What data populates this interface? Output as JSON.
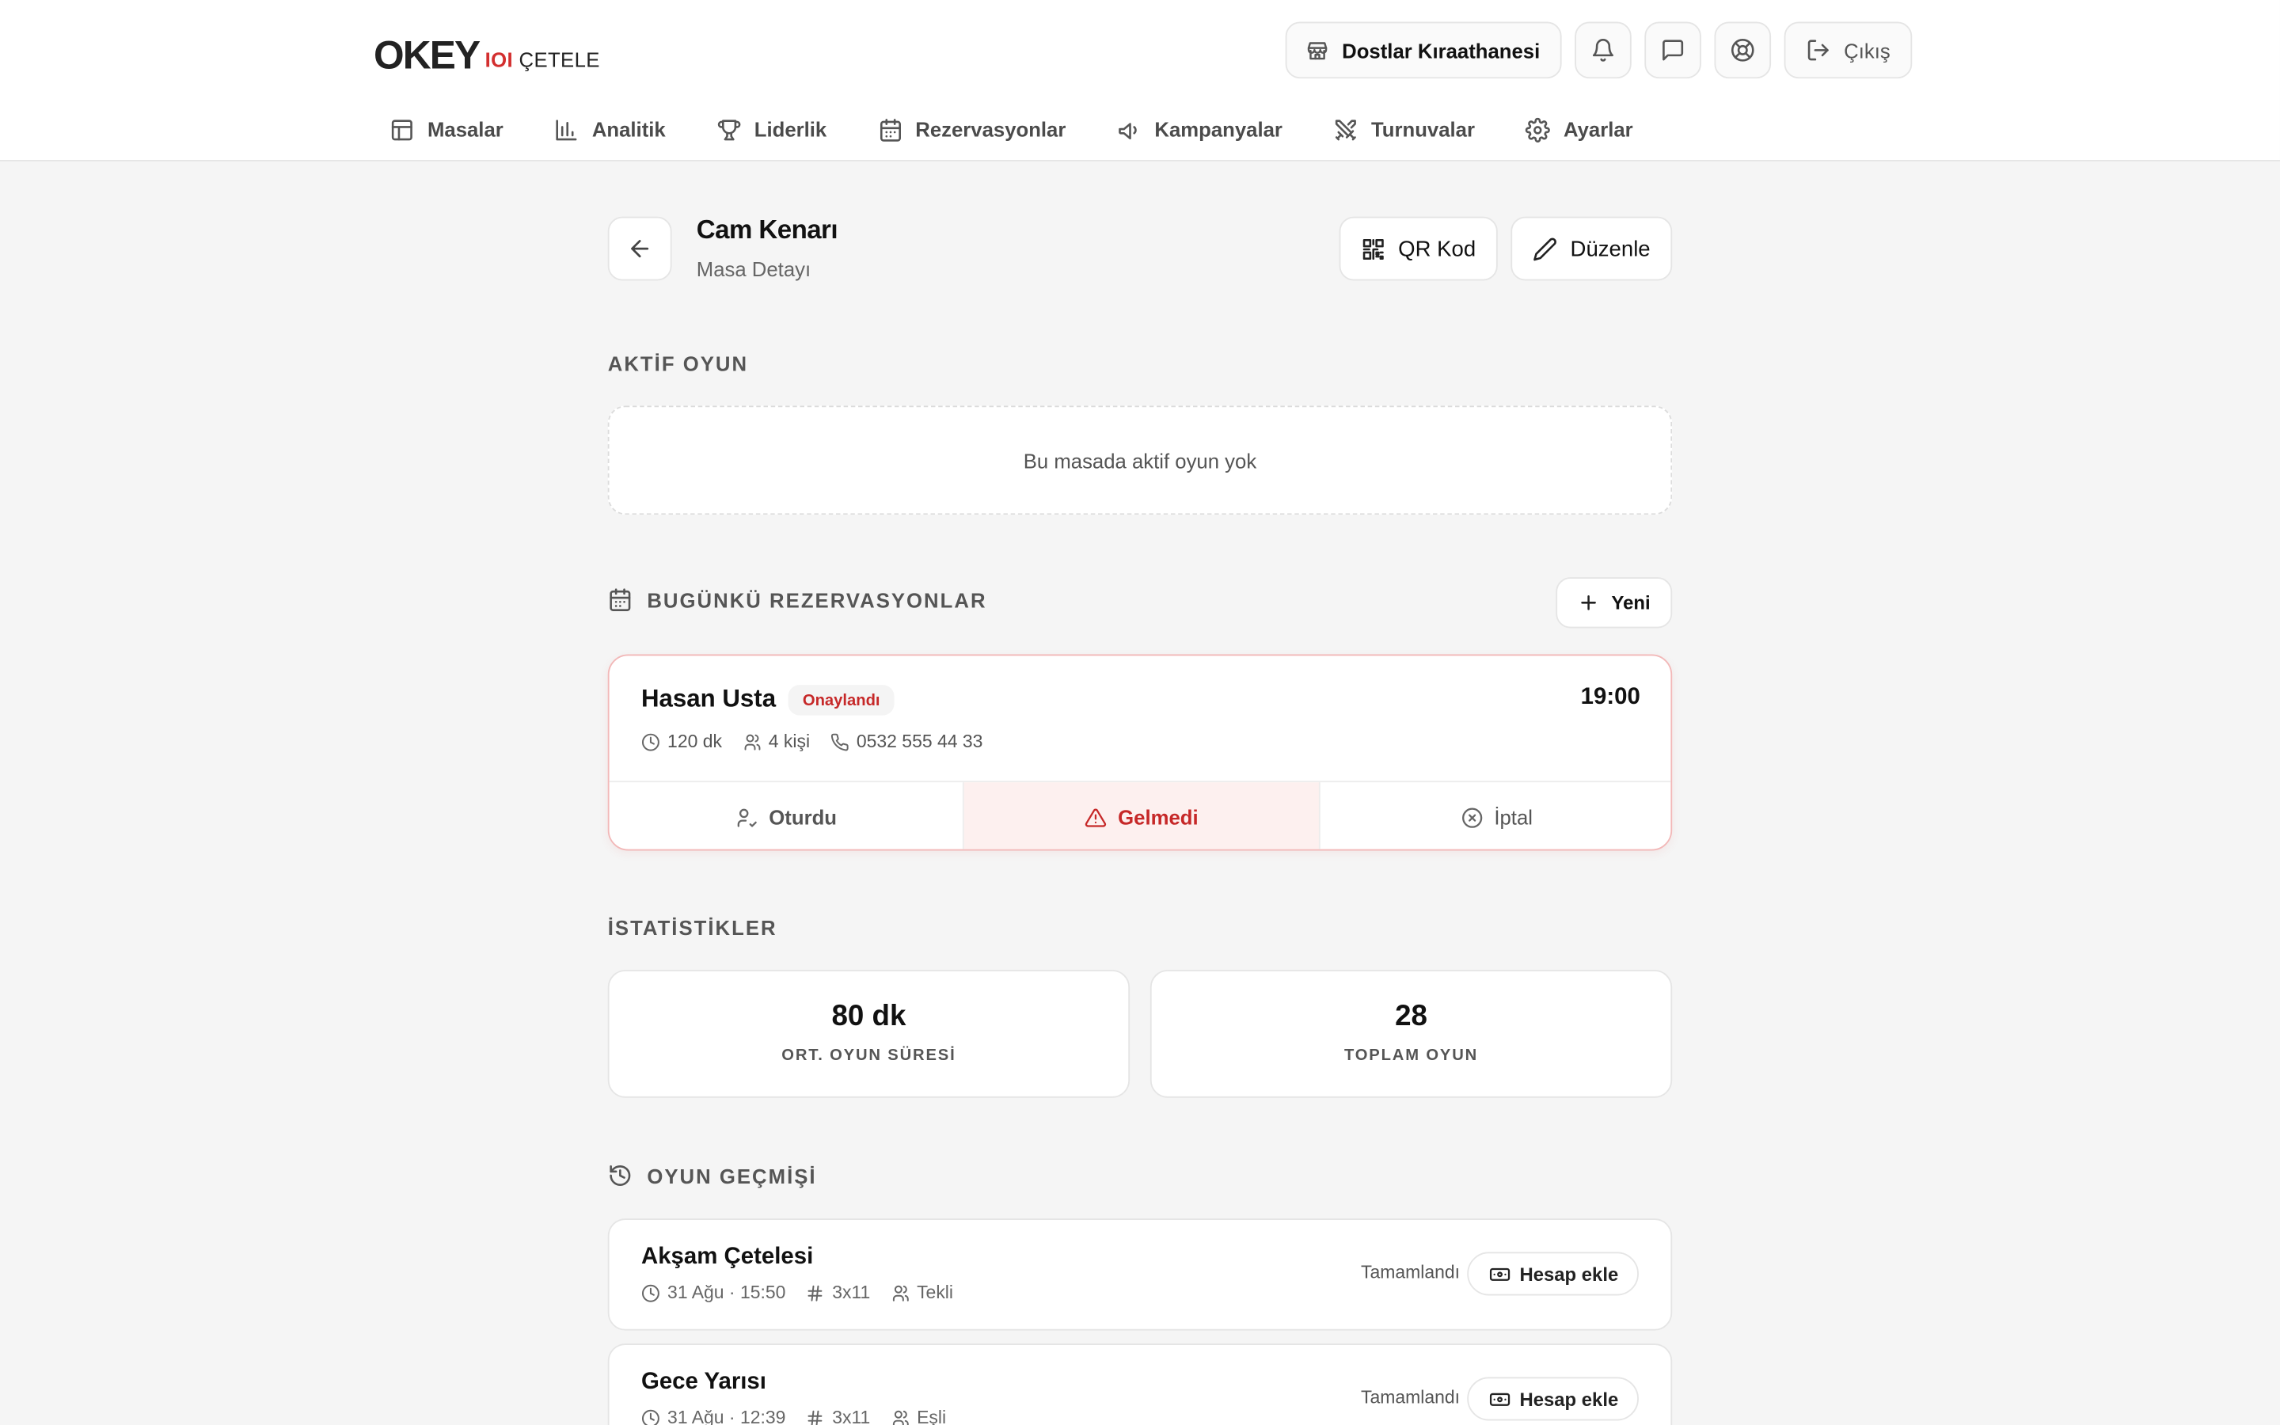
{
  "brand": {
    "logo_main": "OKEY",
    "logo_io": "IOI",
    "logo_sub": "ÇETELE"
  },
  "header": {
    "venue_label": "Dostlar Kıraathanesi",
    "logout_label": "Çıkış"
  },
  "nav": {
    "items": [
      {
        "label": "Masalar",
        "icon": "table-icon"
      },
      {
        "label": "Analitik",
        "icon": "bar-chart-icon"
      },
      {
        "label": "Liderlik",
        "icon": "trophy-icon"
      },
      {
        "label": "Rezervasyonlar",
        "icon": "calendar-icon"
      },
      {
        "label": "Kampanyalar",
        "icon": "megaphone-icon"
      },
      {
        "label": "Turnuvalar",
        "icon": "swords-icon"
      },
      {
        "label": "Ayarlar",
        "icon": "gear-icon"
      }
    ]
  },
  "page": {
    "title": "Cam Kenarı",
    "subtitle": "Masa Detayı",
    "qr_label": "QR Kod",
    "edit_label": "Düzenle"
  },
  "active_game": {
    "section_label": "AKTİF OYUN",
    "empty_text": "Bu masada aktif oyun yok"
  },
  "reservations": {
    "section_label": "BUGÜNKÜ REZERVASYONLAR",
    "new_label": "Yeni",
    "items": [
      {
        "name": "Hasan Usta",
        "status": "Onaylandı",
        "time": "19:00",
        "duration": "120 dk",
        "people": "4 kişi",
        "phone": "0532 555 44 33",
        "actions": {
          "seated": "Oturdu",
          "no_show": "Gelmedi",
          "cancel": "İptal"
        }
      }
    ]
  },
  "stats": {
    "section_label": "İSTATİSTİKLER",
    "cards": [
      {
        "value": "80 dk",
        "label": "ORT. OYUN SÜRESİ"
      },
      {
        "value": "28",
        "label": "TOPLAM OYUN"
      }
    ]
  },
  "history": {
    "section_label": "OYUN GEÇMİŞİ",
    "items": [
      {
        "name": "Akşam Çetelesi",
        "datetime": "31 Ağu · 15:50",
        "format": "3x11",
        "mode": "Tekli",
        "status": "Tamamlandı",
        "action": "Hesap ekle"
      },
      {
        "name": "Gece Yarısı",
        "datetime": "31 Ağu · 12:39",
        "format": "3x11",
        "mode": "Eşli",
        "status": "Tamamlandı",
        "action": "Hesap ekle"
      }
    ]
  },
  "colors": {
    "accent_red": "#c62828",
    "background": "#f5f5f5"
  }
}
